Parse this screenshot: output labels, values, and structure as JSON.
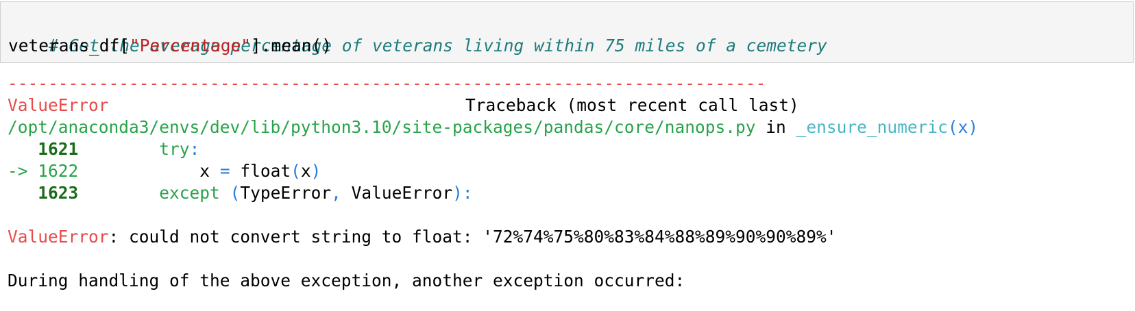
{
  "input_cell": {
    "comment": "# Get the average percentage of veterans living within 75 miles of a cemetery",
    "code_prefix": "veterans_df[",
    "code_string": "\"Percentage\"",
    "code_suffix": "].mean()"
  },
  "traceback": {
    "separator": "---------------------------------------------------------------------------",
    "error_name": "ValueError",
    "header_right": "Traceback (most recent call last)",
    "file_path": "/opt/anaconda3/envs/dev/lib/python3.10/site-packages/pandas/core/nanops.py",
    "in_word": "in",
    "func_name": "_ensure_numeric",
    "func_open": "(",
    "func_arg": "x",
    "func_close": ")",
    "lines": [
      {
        "arrow": "",
        "num": "1621",
        "indent": "        ",
        "kw": "try",
        "rest": ":"
      },
      {
        "arrow": "-> ",
        "num": "1622",
        "indent": "            ",
        "code": "x = float(x)"
      },
      {
        "arrow": "",
        "num": "1623",
        "indent": "        ",
        "kw": "except",
        "rest": " (TypeError, ValueError):"
      }
    ],
    "x_var": "x",
    "eq": "=",
    "float_call": "float",
    "paren_open": "(",
    "paren_close": ")",
    "type_error": "TypeError",
    "comma": ",",
    "value_error": "ValueError",
    "colon": ":"
  },
  "error_message": {
    "name": "ValueError",
    "text": ": could not convert string to float: '72%74%75%80%83%84%88%89%90%90%89%'"
  },
  "during_handling": "During handling of the above exception, another exception occurred:"
}
